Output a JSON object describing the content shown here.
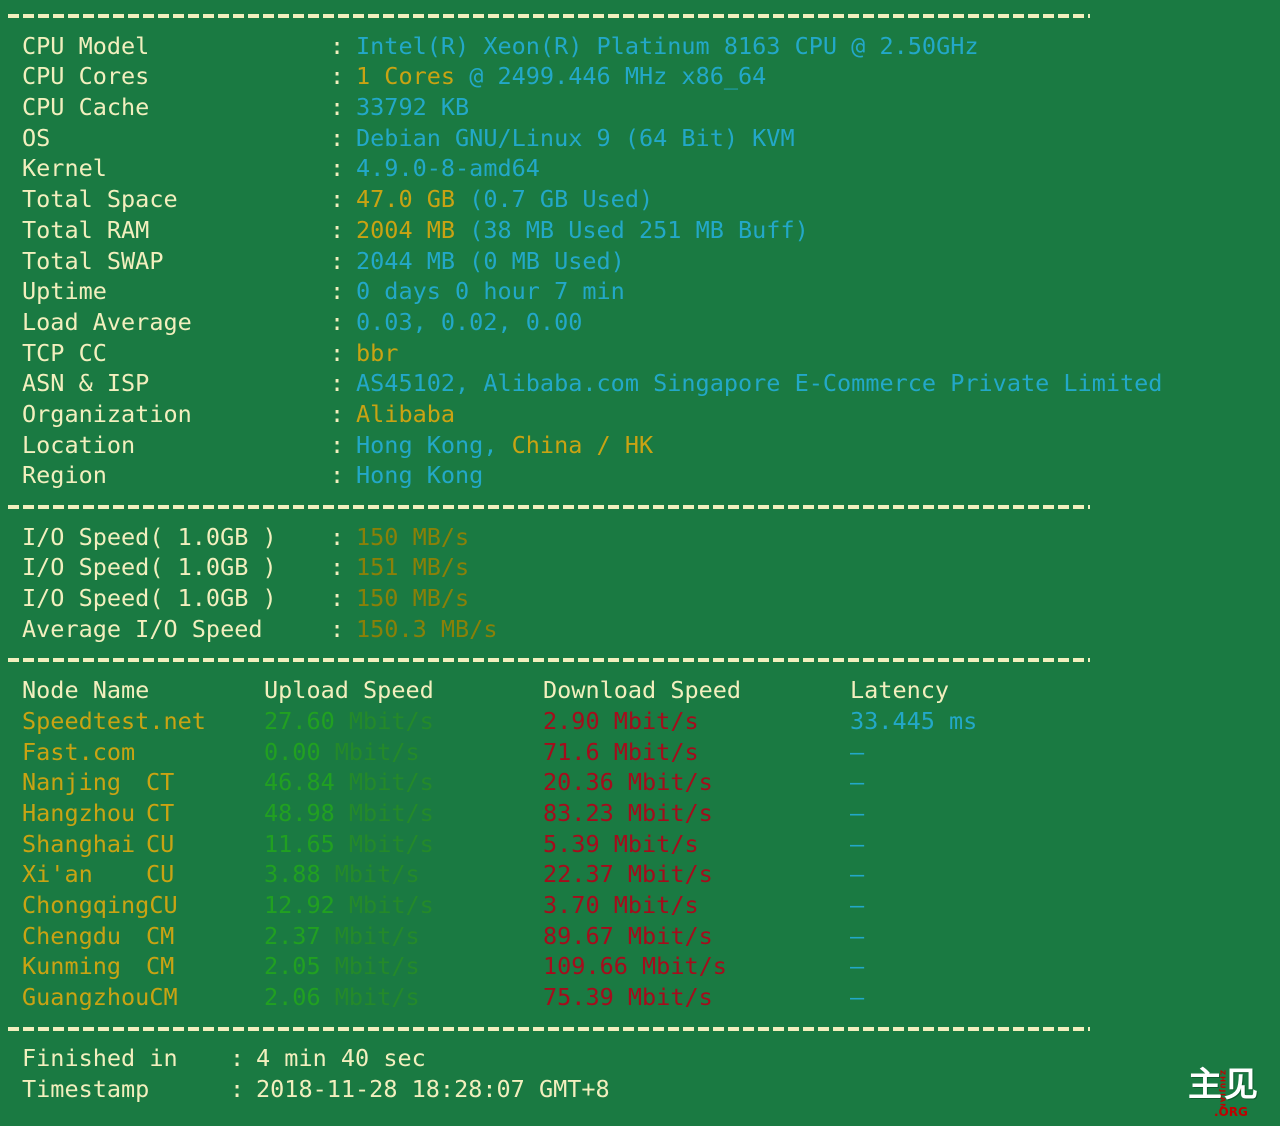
{
  "theme": {
    "background": "#1a7a42",
    "cream": "#f2efbe",
    "cyan": "#23a8c8",
    "gold": "#c9a313",
    "olive": "#8a8008",
    "green_bright": "#21a021",
    "green_dim": "#24892a",
    "red": "#a50c1c"
  },
  "system_info": [
    {
      "label": "CPU Model",
      "colon": ":",
      "value": "Intel(R) Xeon(R) Platinum 8163 CPU @ 2.50GHz",
      "value2": ""
    },
    {
      "label": "CPU Cores",
      "colon": ":",
      "value": "1 Cores",
      "value2": " @ 2499.446 MHz x86_64"
    },
    {
      "label": "CPU Cache",
      "colon": ":",
      "value": "33792 KB",
      "value2": ""
    },
    {
      "label": "OS",
      "colon": ":",
      "value": "Debian GNU/Linux 9 (64 Bit)",
      "value2": " KVM"
    },
    {
      "label": "Kernel",
      "colon": ":",
      "value": "4.9.0-8-amd64",
      "value2": ""
    },
    {
      "label": "Total Space",
      "colon": ":",
      "value": "47.0 GB",
      "value2": " (0.7 GB Used)"
    },
    {
      "label": "Total RAM",
      "colon": ":",
      "value": "2004 MB",
      "value2": " (38 MB Used 251 MB Buff)"
    },
    {
      "label": "Total SWAP",
      "colon": ":",
      "value": "2044 MB (0 MB Used)",
      "value2": ""
    },
    {
      "label": "Uptime",
      "colon": ":",
      "value": "0 days 0 hour 7 min",
      "value2": ""
    },
    {
      "label": "Load Average",
      "colon": ":",
      "value": "0.03, 0.02, 0.00",
      "value2": ""
    },
    {
      "label": "TCP CC",
      "colon": ":",
      "value": "bbr",
      "value2": ""
    },
    {
      "label": "ASN & ISP",
      "colon": ":",
      "value": "AS45102, Alibaba.com Singapore E-Commerce Private Limited",
      "value2": ""
    },
    {
      "label": "Organization",
      "colon": ":",
      "value": "Alibaba",
      "value2": ""
    },
    {
      "label": "Location",
      "colon": ":",
      "value": "Hong Kong,",
      "value2": " China / HK"
    },
    {
      "label": "Region",
      "colon": ":",
      "value": "Hong Kong",
      "value2": ""
    }
  ],
  "io_speed": [
    {
      "label": "I/O Speed( 1.0GB )",
      "colon": ":",
      "value": "150 MB/s"
    },
    {
      "label": "I/O Speed( 1.0GB )",
      "colon": ":",
      "value": "151 MB/s"
    },
    {
      "label": "I/O Speed( 1.0GB )",
      "colon": ":",
      "value": "150 MB/s"
    },
    {
      "label": "Average I/O Speed",
      "colon": ":",
      "value": "150.3 MB/s"
    }
  ],
  "speedtest": {
    "headers": {
      "node": "Node Name",
      "upload": "Upload Speed",
      "download": "Download Speed",
      "latency": "Latency"
    },
    "rows": [
      {
        "node": "Speedtest.net",
        "isp": "",
        "upload_num": "27.60",
        "upload_unit": " Mbit/s",
        "download_num": "2.90",
        "download_unit": " Mbit/s",
        "latency": "33.445 ms"
      },
      {
        "node": "Fast.com",
        "isp": "",
        "upload_num": "0.00",
        "upload_unit": " Mbit/s",
        "download_num": "71.6",
        "download_unit": " Mbit/s",
        "latency": "–"
      },
      {
        "node": "Nanjing",
        "isp": "CT",
        "upload_num": "46.84",
        "upload_unit": " Mbit/s",
        "download_num": "20.36",
        "download_unit": " Mbit/s",
        "latency": "–"
      },
      {
        "node": "Hangzhou",
        "isp": "CT",
        "upload_num": "48.98",
        "upload_unit": " Mbit/s",
        "download_num": "83.23",
        "download_unit": " Mbit/s",
        "latency": "–"
      },
      {
        "node": "Shanghai",
        "isp": "CU",
        "upload_num": "11.65",
        "upload_unit": " Mbit/s",
        "download_num": "5.39",
        "download_unit": " Mbit/s",
        "latency": "–"
      },
      {
        "node": "Xi'an",
        "isp": "CU",
        "upload_num": "3.88",
        "upload_unit": " Mbit/s",
        "download_num": "22.37",
        "download_unit": " Mbit/s",
        "latency": "–"
      },
      {
        "node": "Chongqing",
        "isp": "CU",
        "upload_num": "12.92",
        "upload_unit": " Mbit/s",
        "download_num": "3.70",
        "download_unit": " Mbit/s",
        "latency": "–"
      },
      {
        "node": "Chengdu",
        "isp": "CM",
        "upload_num": "2.37",
        "upload_unit": " Mbit/s",
        "download_num": "89.67",
        "download_unit": " Mbit/s",
        "latency": "–"
      },
      {
        "node": "Kunming",
        "isp": "CM",
        "upload_num": "2.05",
        "upload_unit": " Mbit/s",
        "download_num": "109.66",
        "download_unit": " Mbit/s",
        "latency": "–"
      },
      {
        "node": "Guangzhou",
        "isp": "CM",
        "upload_num": "2.06",
        "upload_unit": " Mbit/s",
        "download_num": "75.39",
        "download_unit": " Mbit/s",
        "latency": "–"
      }
    ]
  },
  "footer": [
    {
      "label": "Finished in",
      "colon": ":",
      "value": "4 min 40 sec"
    },
    {
      "label": "Timestamp",
      "colon": ":",
      "value": "2018-11-28 18:28:07 GMT+8"
    }
  ],
  "watermark": {
    "han": "主见",
    "vertical": "ZHUJIAN",
    "org": ".ORG"
  }
}
